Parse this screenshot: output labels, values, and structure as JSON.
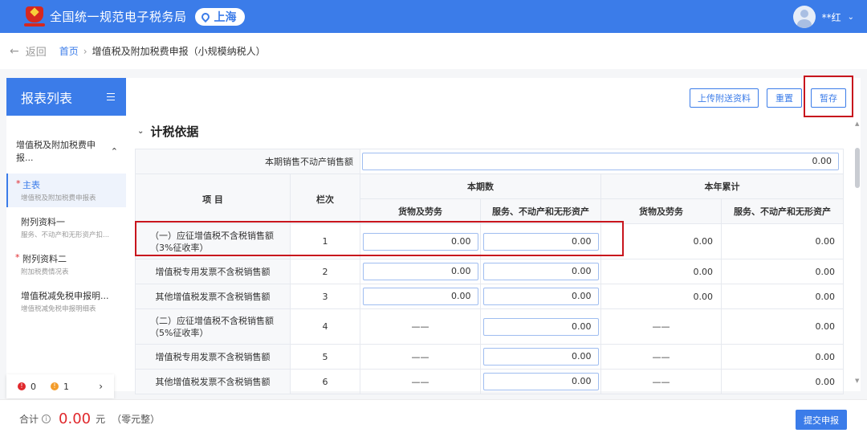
{
  "header": {
    "title": "全国统一规范电子税务局",
    "region": "上海",
    "user": "**红"
  },
  "breadcrumb": {
    "back": "返回",
    "home": "首页",
    "current": "增值税及附加税费申报（小规模纳税人）"
  },
  "sidebar": {
    "title": "报表列表",
    "group": "增值税及附加税费申报...",
    "items": [
      {
        "name": "主表",
        "sub": "增值税及附加税费申报表",
        "required": true
      },
      {
        "name": "附列资料一",
        "sub": "服务、不动产和无形资产扣...",
        "required": false
      },
      {
        "name": "附列资料二",
        "sub": "附加税费情况表",
        "required": true
      },
      {
        "name": "增值税减免税申报明...",
        "sub": "增值税减免税申报明细表",
        "required": false
      }
    ],
    "status": {
      "errors": "0",
      "warnings": "1"
    }
  },
  "toolbar": {
    "upload": "上传附送资料",
    "reset": "重置",
    "save": "暂存"
  },
  "section": {
    "title": "计税依据"
  },
  "table": {
    "real_estate_label": "本期销售不动产销售额",
    "real_estate_value": "0.00",
    "headers": {
      "item": "项 目",
      "line": "栏次",
      "current": "本期数",
      "ytd": "本年累计",
      "goods": "货物及劳务",
      "services": "服务、不动产和无形资产"
    },
    "rows": [
      {
        "label": "（一）应征增值税不含税销售额（3%征收率）",
        "line": "1",
        "c_goods": "0.00",
        "c_serv": "0.00",
        "y_goods": "0.00",
        "y_serv": "0.00"
      },
      {
        "label": "增值税专用发票不含税销售额",
        "line": "2",
        "c_goods": "0.00",
        "c_serv": "0.00",
        "y_goods": "0.00",
        "y_serv": "0.00"
      },
      {
        "label": "其他增值税发票不含税销售额",
        "line": "3",
        "c_goods": "0.00",
        "c_serv": "0.00",
        "y_goods": "0.00",
        "y_serv": "0.00"
      },
      {
        "label": "（二）应征增值税不含税销售额（5%征收率）",
        "line": "4",
        "c_goods": "——",
        "c_serv": "0.00",
        "y_goods": "——",
        "y_serv": "0.00"
      },
      {
        "label": "增值税专用发票不含税销售额",
        "line": "5",
        "c_goods": "——",
        "c_serv": "0.00",
        "y_goods": "——",
        "y_serv": "0.00"
      },
      {
        "label": "其他增值税发票不含税销售额",
        "line": "6",
        "c_goods": "——",
        "c_serv": "0.00",
        "y_goods": "——",
        "y_serv": "0.00"
      }
    ]
  },
  "footer": {
    "total_label": "合计",
    "amount": "0.00",
    "unit": "元",
    "words": "（零元整）",
    "submit": "提交申报"
  },
  "colors": {
    "primary": "#3b7ce9",
    "highlight": "#c8151d",
    "error": "#e0282c",
    "warning": "#f39c2b"
  }
}
